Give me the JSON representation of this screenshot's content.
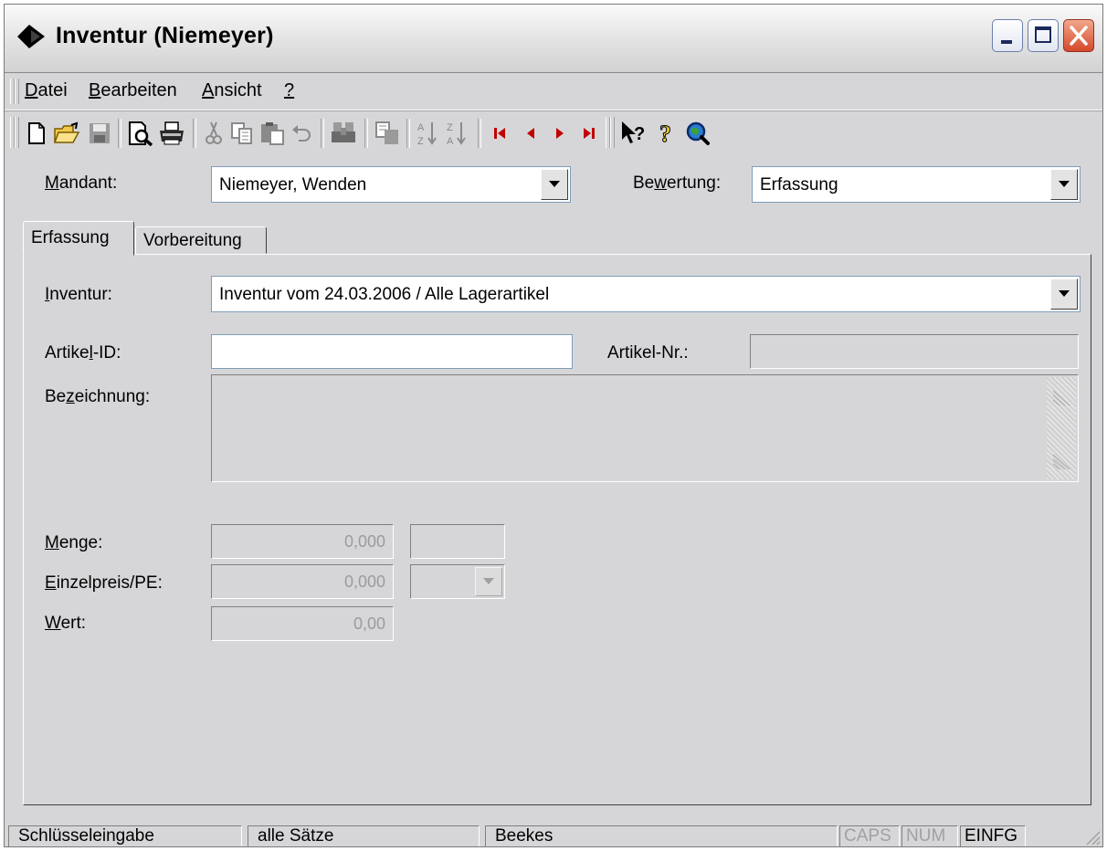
{
  "window": {
    "title": "Inventur (Niemeyer)"
  },
  "menu": [
    {
      "label": "Datei",
      "accel": 0
    },
    {
      "label": "Bearbeiten",
      "accel": 0
    },
    {
      "label": "Ansicht",
      "accel": 0
    },
    {
      "label": "?",
      "accel": 0
    }
  ],
  "toolbar": {
    "icons": [
      "new-file-icon",
      "open-folder-icon",
      "save-disk-icon",
      "print-preview-icon",
      "printer-icon",
      "cut-icon",
      "copy-icon",
      "paste-icon",
      "undo-icon",
      "find-icon",
      "replace-icon",
      "sort-ascending-icon",
      "sort-descending-icon",
      "first-record-icon",
      "previous-record-icon",
      "next-record-icon",
      "last-record-icon",
      "context-help-icon",
      "help-icon",
      "search-web-icon"
    ]
  },
  "header": {
    "mandant_label": "Mandant:",
    "mandant_accel": 0,
    "mandant_value": "Niemeyer, Wenden",
    "bewertung_label": "Bewertung:",
    "bewertung_accel": 2,
    "bewertung_value": "Erfassung"
  },
  "tabs": [
    {
      "label": "Erfassung",
      "active": true
    },
    {
      "label": "Vorbereitung",
      "active": false
    }
  ],
  "form": {
    "inventur_label": "Inventur:",
    "inventur_accel": 0,
    "inventur_value": "Inventur vom 24.03.2006 / Alle Lagerartikel",
    "artikel_id_label": "Artikel-ID:",
    "artikel_id_accel": 6,
    "artikel_id_value": "",
    "artikel_nr_label": "Artikel-Nr.:",
    "artikel_nr_value": "",
    "bezeichnung_label": "Bezeichnung:",
    "bezeichnung_accel": 2,
    "bezeichnung_value": "",
    "menge_label": "Menge:",
    "menge_accel": 0,
    "menge_value": "0,000",
    "menge_unit": "",
    "einzelpreis_label": "Einzelpreis/PE:",
    "einzelpreis_accel": 0,
    "einzelpreis_value": "0,000",
    "einzelpreis_unit": "",
    "wert_label": "Wert:",
    "wert_accel": 0,
    "wert_value": "0,00"
  },
  "statusbar": {
    "mode": "Schlüsseleingabe",
    "filter": "alle Sätze",
    "user": "Beekes",
    "caps": "CAPS",
    "num": "NUM",
    "ins": "EINFG"
  },
  "colors": {
    "nav_red": "#c00000",
    "disabled_text": "#9b9b9b",
    "window_bg": "#d6d6d9"
  }
}
